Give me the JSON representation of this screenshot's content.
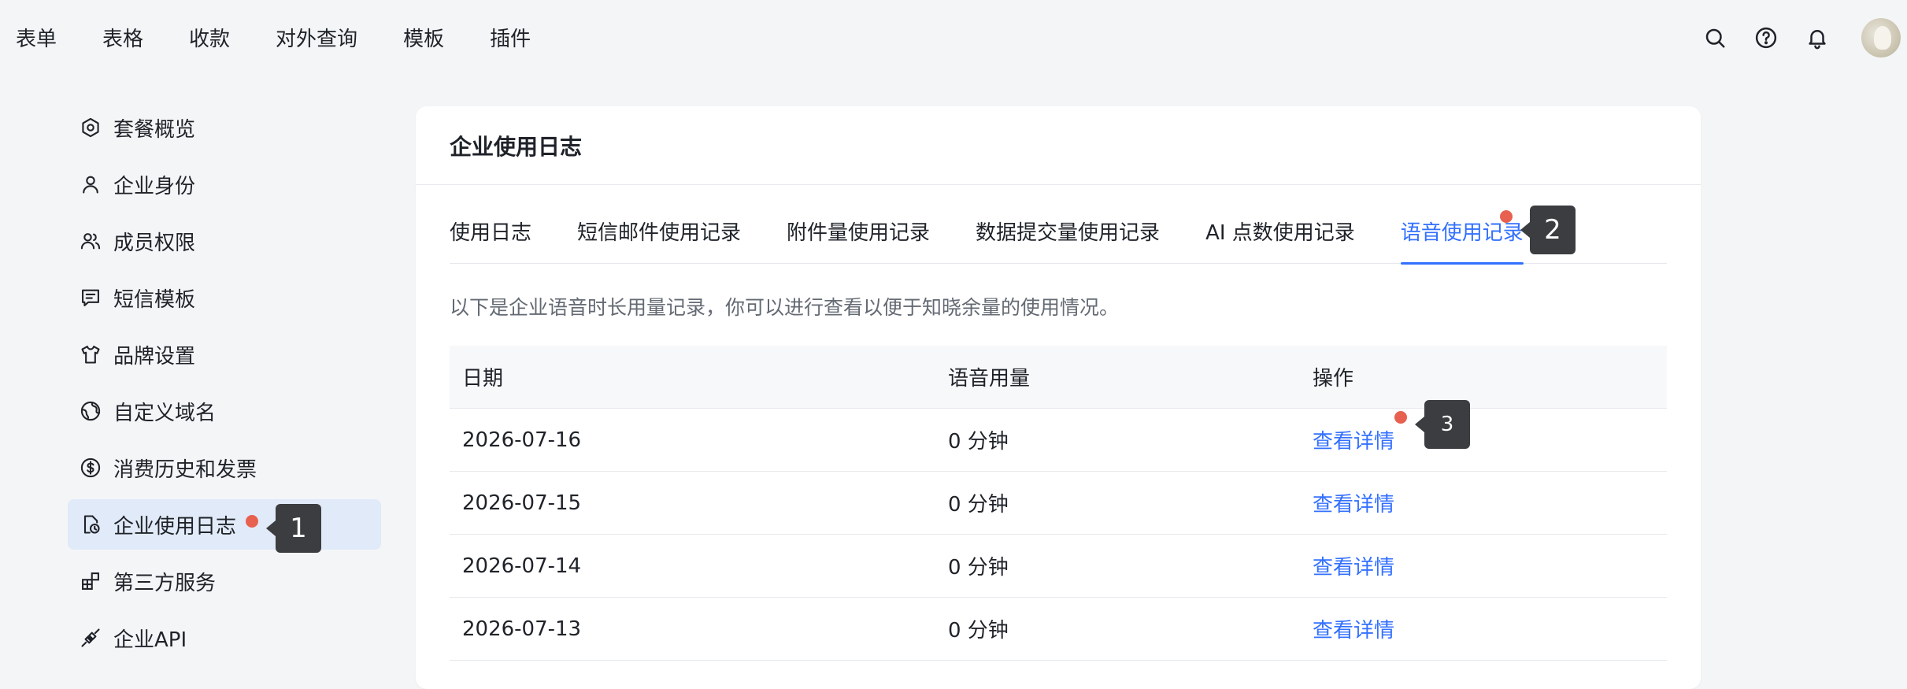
{
  "topnav": {
    "items": [
      "表单",
      "表格",
      "收款",
      "对外查询",
      "模板",
      "插件"
    ],
    "icons": [
      "search-icon",
      "help-icon",
      "bell-icon"
    ]
  },
  "sidebar": {
    "items": [
      {
        "label": "套餐概览",
        "icon": "package-icon"
      },
      {
        "label": "企业身份",
        "icon": "user-icon"
      },
      {
        "label": "成员权限",
        "icon": "members-icon"
      },
      {
        "label": "短信模板",
        "icon": "message-icon"
      },
      {
        "label": "品牌设置",
        "icon": "shirt-icon"
      },
      {
        "label": "自定义域名",
        "icon": "globe-icon"
      },
      {
        "label": "消费历史和发票",
        "icon": "dollar-icon"
      },
      {
        "label": "企业使用日志",
        "icon": "log-icon",
        "active": true
      },
      {
        "label": "第三方服务",
        "icon": "apps-icon"
      },
      {
        "label": "企业API",
        "icon": "api-icon"
      }
    ]
  },
  "card": {
    "title": "企业使用日志",
    "tabs": [
      "使用日志",
      "短信邮件使用记录",
      "附件量使用记录",
      "数据提交量使用记录",
      "AI 点数使用记录",
      "语音使用记录"
    ],
    "active_tab": 5,
    "description": "以下是企业语音时长用量记录，你可以进行查看以便于知晓余量的使用情况。",
    "table": {
      "headers": [
        "日期",
        "语音用量",
        "操作"
      ],
      "rows": [
        {
          "date": "2026-07-16",
          "usage": "0 分钟",
          "action": "查看详情"
        },
        {
          "date": "2026-07-15",
          "usage": "0 分钟",
          "action": "查看详情"
        },
        {
          "date": "2026-07-14",
          "usage": "0 分钟",
          "action": "查看详情"
        },
        {
          "date": "2026-07-13",
          "usage": "0 分钟",
          "action": "查看详情"
        }
      ]
    }
  },
  "annotations": [
    "1",
    "2",
    "3"
  ],
  "colors": {
    "accent": "#3370ff",
    "active_bg": "#e1eaf8",
    "marker_dot": "#e8604f",
    "callout_bg": "#3b3d40"
  }
}
